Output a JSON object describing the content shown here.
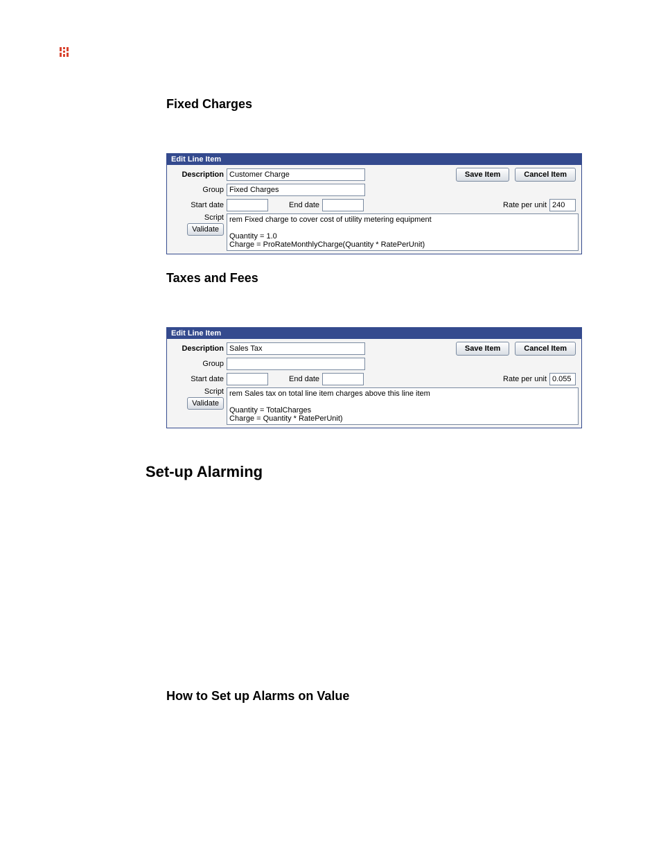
{
  "headings": {
    "fixed_charges": "Fixed Charges",
    "taxes_and_fees": "Taxes and Fees",
    "setup_alarming": "Set-up Alarming",
    "how_to_alarms_value": "How to Set up Alarms on Value"
  },
  "panel_title": "Edit Line Item",
  "labels": {
    "description": "Description",
    "group": "Group",
    "start_date": "Start date",
    "end_date": "End date",
    "rate_per_unit": "Rate per unit",
    "script": "Script",
    "validate": "Validate",
    "save_item": "Save Item",
    "cancel_item": "Cancel Item"
  },
  "panel1": {
    "description": "Customer Charge",
    "group": "Fixed Charges",
    "start_date": "",
    "end_date": "",
    "rate_per_unit": "240",
    "script": "rem Fixed charge to cover cost of utility metering equipment\n\nQuantity = 1.0\nCharge = ProRateMonthlyCharge(Quantity * RatePerUnit)"
  },
  "panel2": {
    "description": "Sales Tax",
    "group": "",
    "start_date": "",
    "end_date": "",
    "rate_per_unit": "0.055",
    "script": "rem Sales tax on total line item charges above this line item\n\nQuantity = TotalCharges\nCharge = Quantity * RatePerUnit)"
  }
}
